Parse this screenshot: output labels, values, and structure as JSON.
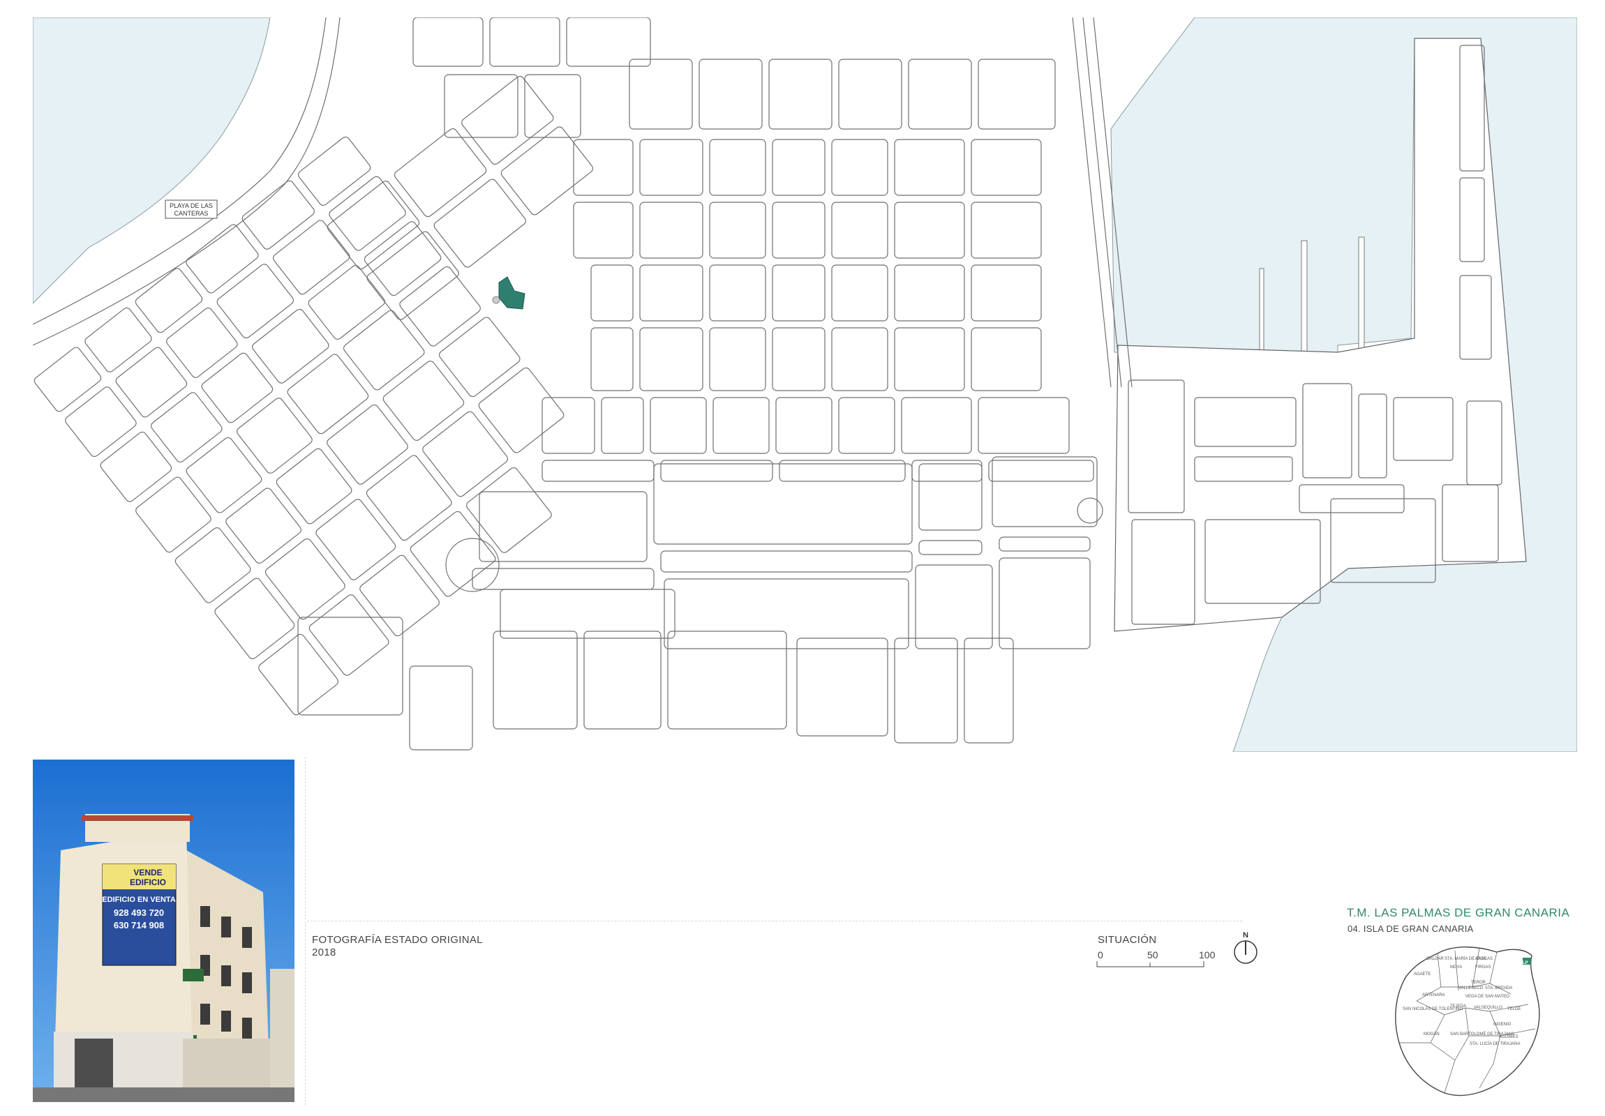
{
  "map": {
    "beach_label_line1": "PLAYA DE LAS",
    "beach_label_line2": "CANTERAS",
    "colors": {
      "sea": "#e6f1f5",
      "streets": "#6f6f6f",
      "site": "#2f7f6e"
    }
  },
  "photo": {
    "caption": "FOTOGRAFÍA ESTADO ORIGINAL",
    "year": "2018",
    "sign": {
      "line1": "VENDE",
      "line2": "EDIFICIO",
      "headline": "EDIFICIO EN VENTA",
      "phone1": "928 493 720",
      "phone2": "630 714 908"
    }
  },
  "situacion": {
    "title": "SITUACIÓN",
    "scale": [
      "0",
      "50",
      "100"
    ],
    "north": "N"
  },
  "island": {
    "title": "T.M. LAS PALMAS DE GRAN CANARIA",
    "subtitle": "04. ISLA DE GRAN CANARIA",
    "municipalities": [
      "GALDAR",
      "STA. MARÍA DE GUÍA",
      "ARUCAS",
      "MOYA",
      "AGAETE",
      "FIRGAS",
      "TEROR",
      "VALLESECO",
      "STA. BRÍGIDA",
      "ARTENARA",
      "VEGA DE SAN MATEO",
      "TEJEDA",
      "SAN NICOLÁS DE TOLENTINO",
      "TELDE",
      "VALSEQUILLO",
      "INGENIO",
      "MOGÁN",
      "SAN BARTOLOMÉ DE TIRAJANA",
      "AGÜIMES",
      "STA. LUCÍA DE TIRAJANA",
      "LP"
    ]
  }
}
